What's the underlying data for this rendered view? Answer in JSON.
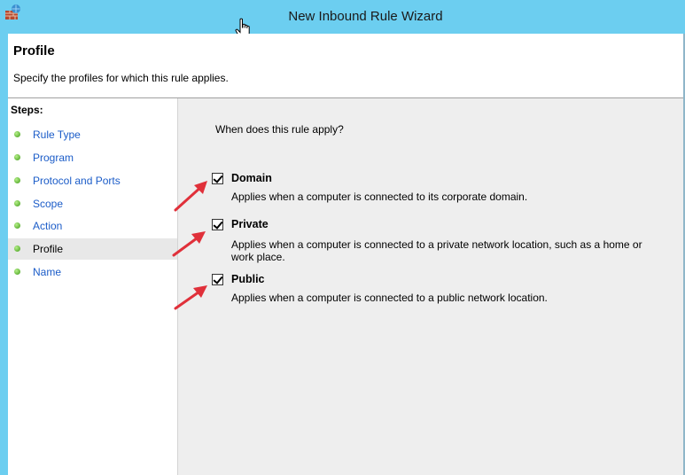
{
  "window": {
    "title": "New Inbound Rule Wizard",
    "icon": "firewall-icon"
  },
  "header": {
    "title": "Profile",
    "subtitle": "Specify the profiles for which this rule applies."
  },
  "steps": {
    "title": "Steps:",
    "items": [
      {
        "label": "Rule Type"
      },
      {
        "label": "Program"
      },
      {
        "label": "Protocol and Ports"
      },
      {
        "label": "Scope"
      },
      {
        "label": "Action"
      },
      {
        "label": "Profile",
        "active": true
      },
      {
        "label": "Name"
      }
    ]
  },
  "main": {
    "question": "When does this rule apply?",
    "options": [
      {
        "label": "Domain",
        "checked": true,
        "description": "Applies when a computer is connected to its corporate domain."
      },
      {
        "label": "Private",
        "checked": true,
        "description": "Applies when a computer is connected to a private network location, such as a home or work place."
      },
      {
        "label": "Public",
        "checked": true,
        "description": "Applies when a computer is connected to a public network location."
      }
    ]
  },
  "colors": {
    "titlebar": "#6ccef0",
    "link": "#1b5cc8",
    "annotation_arrow": "#e0303a",
    "content_bg": "#eeeeee"
  }
}
